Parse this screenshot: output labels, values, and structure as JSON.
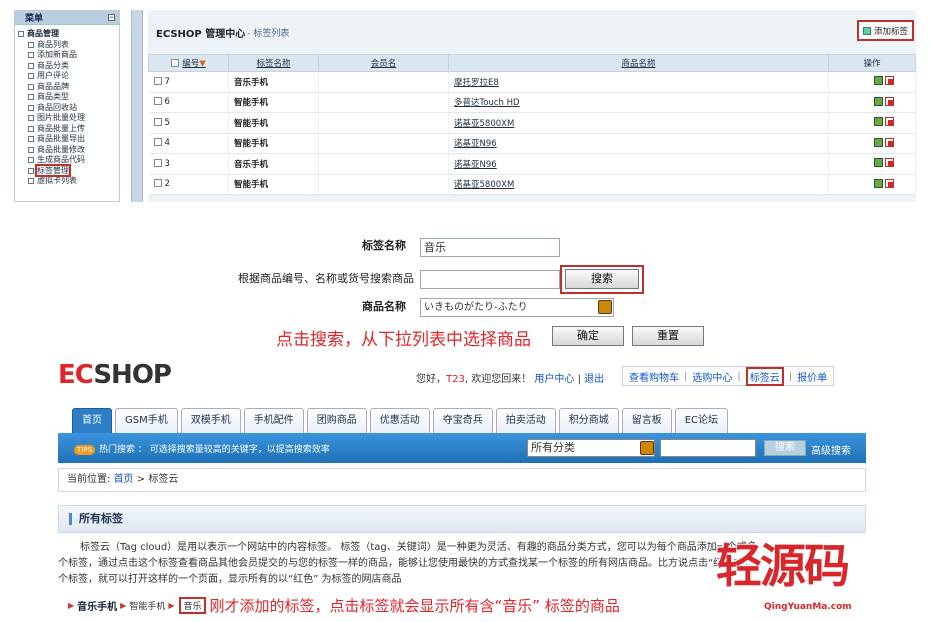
{
  "admin": {
    "menu_title": "菜单",
    "menu_toggle": "□",
    "tree_root": "商品管理",
    "tree_items": [
      "商品列表",
      "添加新商品",
      "商品分类",
      "用户评论",
      "商品品牌",
      "商品类型",
      "商品回收站",
      "图片批量处理",
      "商品批量上传",
      "商品批量导出",
      "商品批量修改",
      "生成商品代码",
      "标签管理",
      "虚拟卡列表"
    ],
    "selected_item": "标签管理",
    "page_title": "ECSHOP 管理中心",
    "page_sub": "- 标签列表",
    "add_tag_label": "添加标签",
    "table": {
      "headers": {
        "id": "编号",
        "name": "标签名称",
        "member": "会员名",
        "goods": "商品名称",
        "ops": "操作"
      },
      "sort_arrow": "▼",
      "rows": [
        {
          "id": "7",
          "name": "音乐手机",
          "member": "",
          "goods": "摩托罗拉E8"
        },
        {
          "id": "6",
          "name": "智能手机",
          "member": "",
          "goods": "多普达Touch HD"
        },
        {
          "id": "5",
          "name": "智能手机",
          "member": "",
          "goods": "诺基亚5800XM"
        },
        {
          "id": "4",
          "name": "智能手机",
          "member": "",
          "goods": "诺基亚N96"
        },
        {
          "id": "3",
          "name": "音乐手机",
          "member": "",
          "goods": "诺基亚N96"
        },
        {
          "id": "2",
          "name": "智能手机",
          "member": "",
          "goods": "诺基亚5800XM"
        }
      ]
    }
  },
  "form": {
    "tag_name_label": "标签名称",
    "tag_name_value": "音乐",
    "search_label": "根据商品编号、名称或货号搜索商品",
    "search_value": "",
    "search_button": "搜索",
    "goods_name_label": "商品名称",
    "goods_name_value": "いきものがたり-ふたり",
    "note": "点击搜索，从下拉列表中选择商品",
    "confirm_button": "确定",
    "reset_button": "重置"
  },
  "shop": {
    "logo_e": "EC",
    "logo_rest": "SHOP",
    "welcome_pre": "您好，",
    "user": "T23",
    "welcome_post": "欢迎您回来！",
    "user_center": "用户中心",
    "logout": "退出",
    "top_links": [
      "查看购物车",
      "选购中心",
      "标签云",
      "报价单"
    ],
    "nav": [
      "首页",
      "GSM手机",
      "双模手机",
      "手机配件",
      "团购商品",
      "优惠活动",
      "夺宝奇兵",
      "拍卖活动",
      "积分商城",
      "留言板",
      "EC论坛"
    ],
    "hot_tag": "TIPS",
    "hot_search": "热门搜索 ： 可选择搜索量较高的关键字，以提高搜索效率",
    "category": "所有分类",
    "search_button": "搜索",
    "advanced": "高级搜索",
    "crumb_prefix": "当前位置:",
    "crumb_home": "首页",
    "crumb_sep": ">",
    "crumb_current": "标签云",
    "all_tags": "所有标签",
    "desc": "标签云（Tag cloud）是用以表示一个网站中的内容标签。 标签（tag、关键词）是一种更为灵活、有趣的商品分类方式，您可以为每个商品添加一个或多个标签，通过点击这个标签查看商品其他会员提交的与您的标签一样的商品，能够让您使用最快的方式查找某一个标签的所有网店商品。比方说点击“红色”这个标签，就可以打开这样的一个页面，显示所有的以“红色” 为标签的网店商品",
    "tags": [
      "音乐手机",
      "智能手机",
      "音乐"
    ],
    "tag_note": "刚才添加的标签，点击标签就会显示所有含“音乐” 标签的商品"
  },
  "watermark": {
    "big": "轻源码",
    "small": "QingYuanMa.com"
  }
}
